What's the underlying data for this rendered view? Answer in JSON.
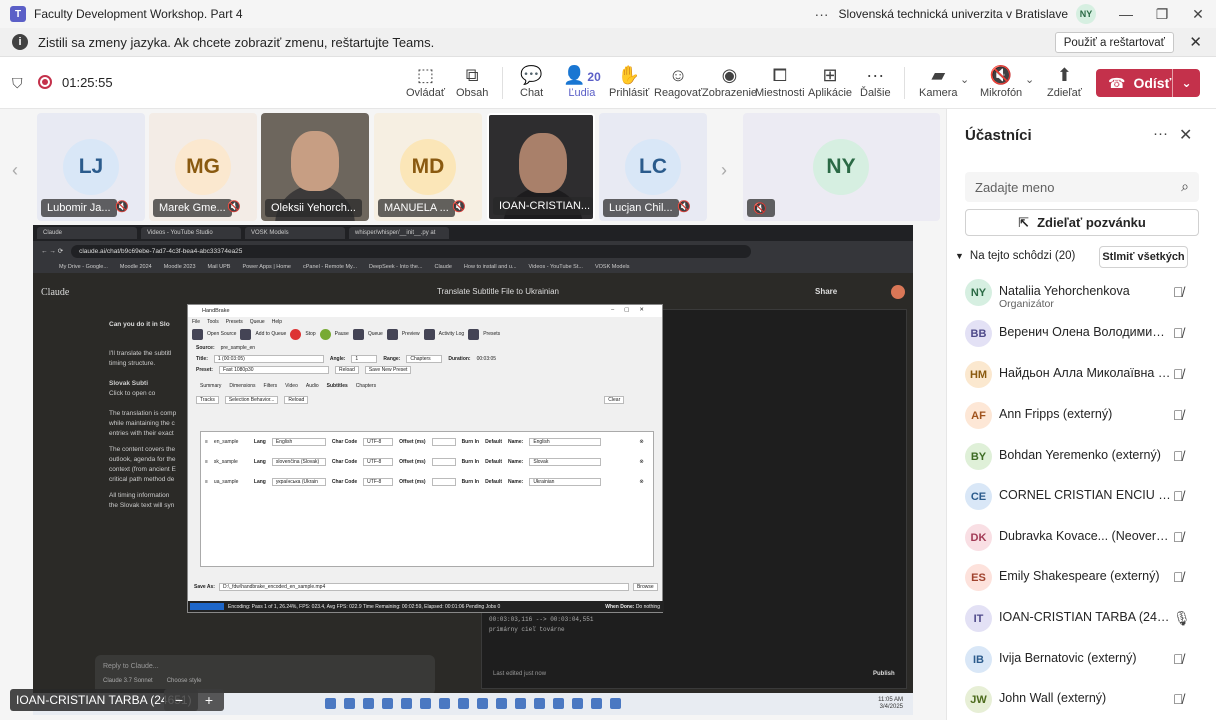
{
  "window": {
    "title": "Faculty Development Workshop. Part 4",
    "org": "Slovenská technická univerzita v Bratislave",
    "user_initials": "NY"
  },
  "infobar": {
    "message": "Zistili sa zmeny jazyka. Ak chcete zobraziť zmenu, reštartujte Teams.",
    "button": "Použiť a reštartovať"
  },
  "meeting": {
    "elapsed": "01:25:55"
  },
  "toolbar": {
    "ovladat": "Ovládať",
    "obsah": "Obsah",
    "chat": "Chat",
    "ludia": "Ľudia",
    "ludia_count": "20",
    "prihlasit": "Prihlásiť",
    "reagovat": "Reagovať",
    "zobrazenie": "Zobrazenie",
    "miestnosti": "Miestnosti",
    "aplikacie": "Aplikácie",
    "dalsie": "Ďalšie",
    "kamera": "Kamera",
    "mikrofon": "Mikrofón",
    "zdielat": "Zdieľať",
    "odist": "Odísť"
  },
  "tiles": [
    {
      "initials": "LJ",
      "name": "Lubomir Ja..."
    },
    {
      "initials": "MG",
      "name": "Marek Gme..."
    },
    {
      "initials": "",
      "name": "Oleksii Yehorch..."
    },
    {
      "initials": "MD",
      "name": "MANUELA ..."
    },
    {
      "initials": "",
      "name": "IOAN-CRISTIAN..."
    },
    {
      "initials": "LC",
      "name": "Lucjan Chil..."
    },
    {
      "initials": "NY",
      "name": ""
    }
  ],
  "share": {
    "tabs": [
      "Claude",
      "Videos - YouTube Studio",
      "VOSK Models",
      "whisper/whisper/__init__.py at"
    ],
    "url": "claude.ai/chat/b9c69ebe-7ad7-4c3f-bea4-abc33374ea25",
    "bookmarks": [
      "My Drive - Google...",
      "Moodle 2024",
      "Moodle 2023",
      "Mail UPB",
      "Power Apps | Home",
      "cPanel - Remote My...",
      "DeepSeek - Into the...",
      "Claude",
      "How to install and u...",
      "Videos - YouTube St...",
      "VOSK Models"
    ],
    "brand": "Claude",
    "chat_title": "Translate Subtitle File to Ukrainian",
    "share_btn": "Share",
    "user_msg": "Can you do it in Slo",
    "body_lines": [
      "I'll translate the subtitl",
      "timing structure.",
      "Slovak Subti",
      "Click to open co",
      "The translation is comp",
      "while maintaining the c",
      "entries with their exact",
      "The content covers the",
      "outlook, agenda for the",
      "context (from ancient E",
      "critical path method de",
      "All timing information",
      "the Slovak text will syn"
    ],
    "code_lines": [
      "00:03:03,116 --> 00:03:04,551",
      "primárny cieľ továrne"
    ],
    "reply_placeholder": "Reply to Claude...",
    "model": "Claude 3.7 Sonnet",
    "style": "Choose style",
    "last_edited": "Last edited just now",
    "publish": "Publish",
    "clock_time": "11:05 AM",
    "clock_date": "3/4/2025"
  },
  "handbrake": {
    "title": "HandBrake",
    "menu": [
      "File",
      "Tools",
      "Presets",
      "Queue",
      "Help"
    ],
    "tools": [
      "Open Source",
      "Add to Queue",
      "Stop",
      "Pause",
      "Queue",
      "Preview",
      "Activity Log",
      "Presets"
    ],
    "source": "pre_sample_en",
    "title_val": "1 (00:03:05)",
    "angle": "1",
    "range": "Chapters",
    "duration_label": "Duration:",
    "duration": "00:03:05",
    "preset": "Fast 1080p30",
    "reload": "Reload",
    "save_preset": "Save New Preset",
    "tabs": [
      "Summary",
      "Dimensions",
      "Filters",
      "Video",
      "Audio",
      "Subtitles",
      "Chapters"
    ],
    "tracks_btn": "Tracks",
    "selection_btn": "Selection Behavior...",
    "reload2": "Reload",
    "clear": "Clear",
    "tracks": [
      {
        "file": "en_sample",
        "lang": "English",
        "code": "UTF-8",
        "name": "English"
      },
      {
        "file": "sk_sample",
        "lang": "slovenčina (Slovak)",
        "code": "UTF-8",
        "name": "Slovak"
      },
      {
        "file": "ua_sample",
        "lang": "українська (Ukrain",
        "code": "UTF-8",
        "name": "Ukrainian"
      }
    ],
    "lbl_lang": "Lang",
    "lbl_charcode": "Char Code",
    "lbl_offset": "Offset (ms)",
    "lbl_burn": "Burn In",
    "lbl_default": "Default",
    "lbl_name": "Name:",
    "save_as_label": "Save As:",
    "save_as": "D:\\_fdw\\handbrake_encoded_en_sample.mp4",
    "browse": "Browse",
    "status": "Encoding: Pass 1 of 1, 26.24%, FPS: 023.4, Avg FPS: 022.9 Time Remaining: 00:02:59, Elapsed: 00:01:06 Pending Jobs 0",
    "when_done_label": "When Done:",
    "when_done": "Do nothing"
  },
  "presenter": "IOAN-CRISTIAN TARBA (24651)",
  "panel": {
    "title": "Účastníci",
    "search_placeholder": "Zadajte meno",
    "invite": "Zdieľať pozvánku",
    "section": "Na tejto schôdzi (20)",
    "mute_all": "Stlmiť všetkých",
    "people": [
      {
        "initials": "NY",
        "name": "Nataliia Yehorchenkova",
        "role": "Organizátor",
        "bg": "#d6efe1",
        "fg": "#2b6a45",
        "mic": "off"
      },
      {
        "initials": "BB",
        "name": "Веренич Олена Володимирів...",
        "role": "",
        "bg": "#e3e1f5",
        "fg": "#4f4a8a",
        "mic": "off"
      },
      {
        "initials": "HM",
        "name": "Найдьон Алла Миколаївна (...",
        "role": "",
        "bg": "#fbe8cf",
        "fg": "#8a5a10",
        "mic": "off"
      },
      {
        "initials": "AF",
        "name": "Ann Fripps (externý)",
        "role": "",
        "bg": "#fde7d6",
        "fg": "#a0531d",
        "mic": "off"
      },
      {
        "initials": "BY",
        "name": "Bohdan Yeremenko (externý)",
        "role": "",
        "bg": "#dff0d8",
        "fg": "#3d6b24",
        "mic": "off"
      },
      {
        "initials": "CE",
        "name": "CORNEL CRISTIAN ENCIU (711...",
        "role": "",
        "bg": "#d9e7f7",
        "fg": "#2b5b8c",
        "mic": "off"
      },
      {
        "initials": "DK",
        "name": "Dubravka Kovace...  (Neoverené)",
        "role": "",
        "bg": "#f9dfe4",
        "fg": "#a23a55",
        "mic": "off"
      },
      {
        "initials": "ES",
        "name": "Emily Shakespeare (externý)",
        "role": "",
        "bg": "#fde2dc",
        "fg": "#a0432e",
        "mic": "off"
      },
      {
        "initials": "IT",
        "name": "IOAN-CRISTIAN TARBA (24651)",
        "role": "",
        "bg": "#e3e1f5",
        "fg": "#4f4a8a",
        "mic": "on"
      },
      {
        "initials": "IB",
        "name": "Ivija Bernatovic (externý)",
        "role": "",
        "bg": "#d9e7f7",
        "fg": "#2b5b8c",
        "mic": "off"
      },
      {
        "initials": "JW",
        "name": "John Wall (externý)",
        "role": "",
        "bg": "#e7efd6",
        "fg": "#4d6b1c",
        "mic": "off"
      }
    ]
  }
}
